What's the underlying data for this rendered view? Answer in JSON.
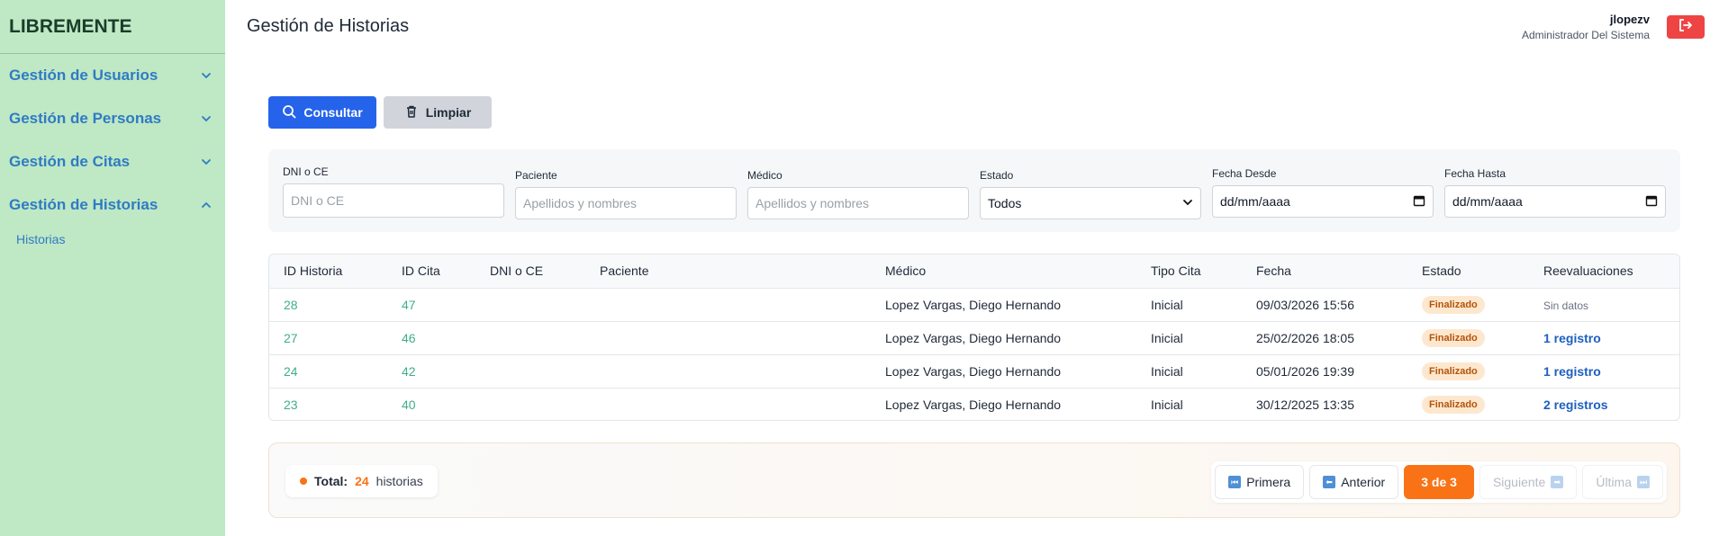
{
  "sidebar": {
    "brand": "LIBREMENTE",
    "sections": [
      {
        "label": "Gestión de Usuarios",
        "expanded": false
      },
      {
        "label": "Gestión de Personas",
        "expanded": false
      },
      {
        "label": "Gestión de Citas",
        "expanded": false
      },
      {
        "label": "Gestión de Historias",
        "expanded": true
      }
    ],
    "sub_item": "Historias"
  },
  "header": {
    "title": "Gestión de Historias",
    "user_name": "jlopezv",
    "user_role": "Administrador Del Sistema",
    "logout_icon": "logout-icon"
  },
  "actions": {
    "consultar": "Consultar",
    "limpiar": "Limpiar"
  },
  "filters": {
    "dni_label": "DNI o CE",
    "dni_placeholder": "DNI o CE",
    "paciente_label": "Paciente",
    "paciente_placeholder": "Apellidos y nombres",
    "medico_label": "Médico",
    "medico_placeholder": "Apellidos y nombres",
    "estado_label": "Estado",
    "estado_value": "Todos",
    "desde_label": "Fecha Desde",
    "desde_value": "dd/mm/aaaa",
    "hasta_label": "Fecha Hasta",
    "hasta_value": "dd/mm/aaaa"
  },
  "table": {
    "columns": [
      "ID Historia",
      "ID Cita",
      "DNI o CE",
      "Paciente",
      "Médico",
      "Tipo Cita",
      "Fecha",
      "Estado",
      "Reevaluaciones"
    ],
    "rows": [
      {
        "id_historia": "28",
        "id_cita": "47",
        "dni": "",
        "paciente": "",
        "medico": "Lopez Vargas, Diego Hernando",
        "tipo": "Inicial",
        "fecha": "09/03/2026 15:56",
        "estado": "Finalizado",
        "reevaluaciones": "Sin datos"
      },
      {
        "id_historia": "27",
        "id_cita": "46",
        "dni": "",
        "paciente": "",
        "medico": "Lopez Vargas, Diego Hernando",
        "tipo": "Inicial",
        "fecha": "25/02/2026 18:05",
        "estado": "Finalizado",
        "reevaluaciones": "1 registro"
      },
      {
        "id_historia": "24",
        "id_cita": "42",
        "dni": "",
        "paciente": "",
        "medico": "Lopez Vargas, Diego Hernando",
        "tipo": "Inicial",
        "fecha": "05/01/2026 19:39",
        "estado": "Finalizado",
        "reevaluaciones": "1 registro"
      },
      {
        "id_historia": "23",
        "id_cita": "40",
        "dni": "",
        "paciente": "",
        "medico": "Lopez Vargas, Diego Hernando",
        "tipo": "Inicial",
        "fecha": "30/12/2025 13:35",
        "estado": "Finalizado",
        "reevaluaciones": "2 registros"
      }
    ]
  },
  "footer": {
    "total_label": "Total:",
    "total_count": "24",
    "total_suffix": "historias",
    "primera": "Primera",
    "anterior": "Anterior",
    "current": "3 de 3",
    "siguiente": "Siguiente",
    "ultima": "Última"
  },
  "colors": {
    "sidebar_bg": "#bfe8c4",
    "primary": "#2563eb",
    "accent": "#f97316",
    "danger": "#ef4444"
  }
}
